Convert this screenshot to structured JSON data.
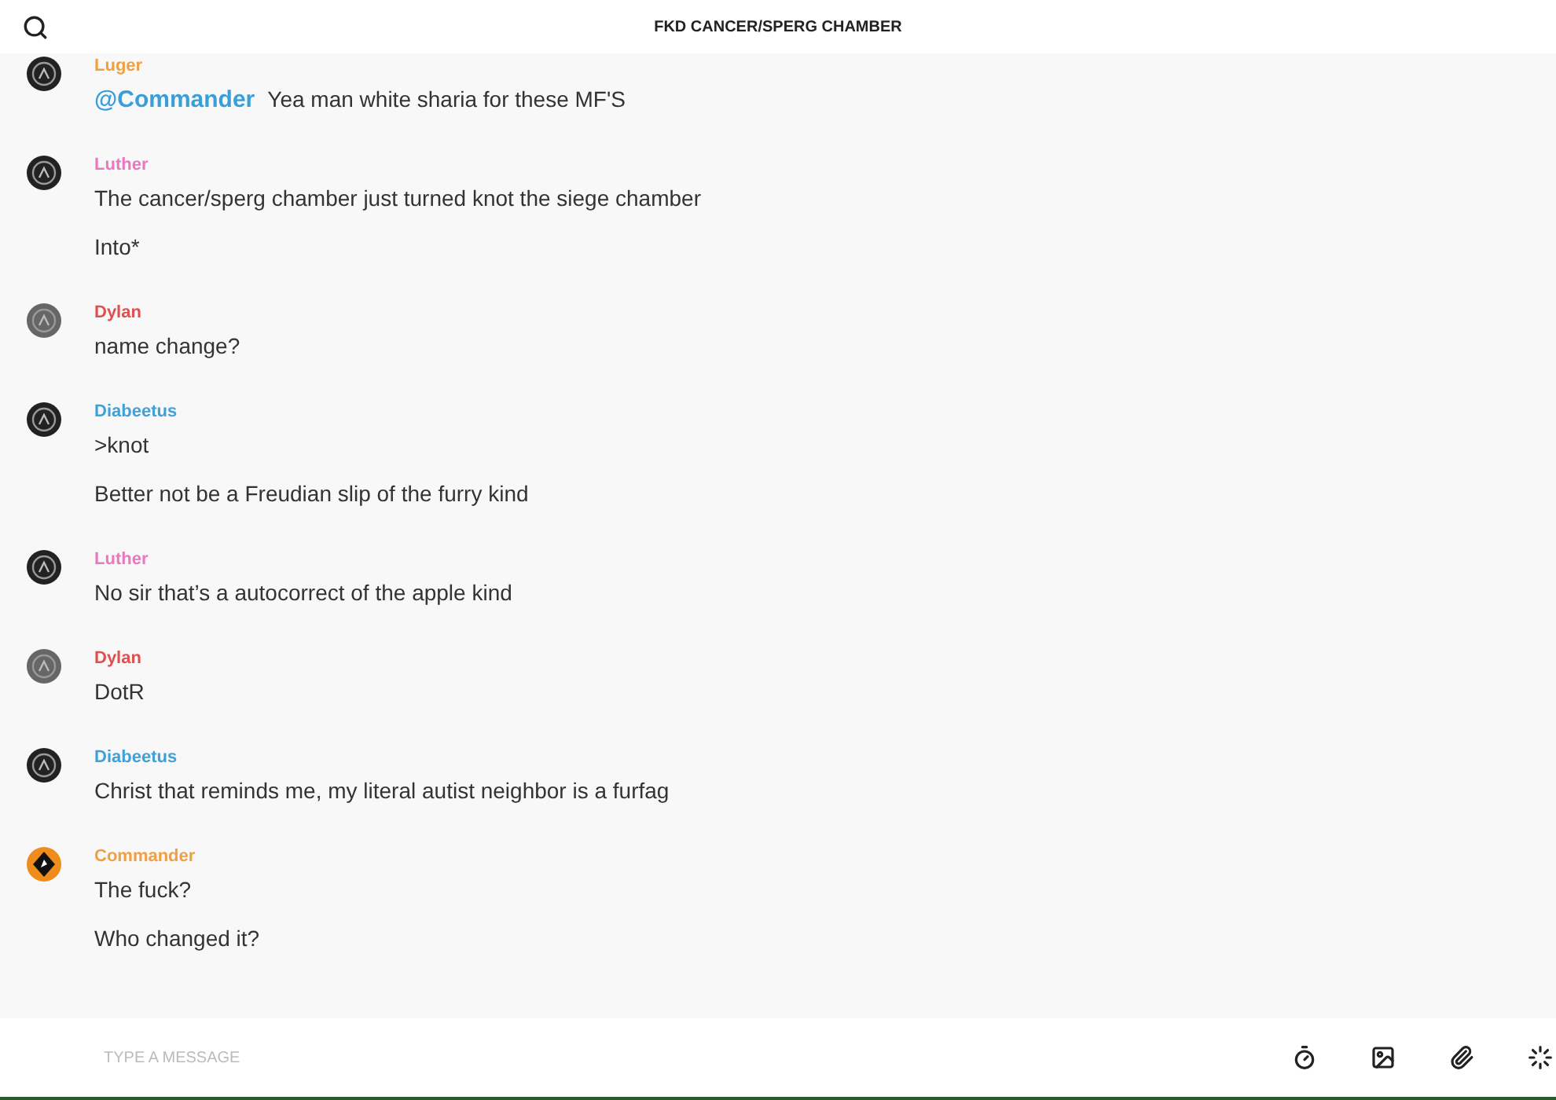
{
  "header": {
    "title": "FKD CANCER/SPERG CHAMBER"
  },
  "groups": [
    {
      "sender": "Luger",
      "color": "#f0a040",
      "avatar": {
        "kind": "dark"
      },
      "lines": [
        {
          "mention": "@Commander",
          "text": "Yea man white sharia for these MF'S"
        }
      ]
    },
    {
      "sender": "Luther",
      "color": "#e878c0",
      "avatar": {
        "kind": "dark"
      },
      "lines": [
        {
          "text": "The cancer/sperg chamber just turned knot the siege chamber"
        },
        {
          "text": "Into*"
        }
      ]
    },
    {
      "sender": "Dylan",
      "color": "#e05050",
      "avatar": {
        "kind": "grey"
      },
      "lines": [
        {
          "text": "name change?"
        }
      ]
    },
    {
      "sender": "Diabeetus",
      "color": "#40a0d8",
      "avatar": {
        "kind": "dark"
      },
      "lines": [
        {
          "text": ">knot"
        },
        {
          "text": "Better not be a Freudian slip of the furry kind"
        }
      ]
    },
    {
      "sender": "Luther",
      "color": "#e878c0",
      "avatar": {
        "kind": "dark"
      },
      "lines": [
        {
          "text": "No sir that’s a autocorrect of the apple kind"
        }
      ]
    },
    {
      "sender": "Dylan",
      "color": "#e05050",
      "avatar": {
        "kind": "grey"
      },
      "lines": [
        {
          "text": "DotR"
        }
      ]
    },
    {
      "sender": "Diabeetus",
      "color": "#40a0d8",
      "avatar": {
        "kind": "dark"
      },
      "lines": [
        {
          "text": "Christ that reminds me, my literal autist neighbor is a furfag"
        }
      ]
    },
    {
      "sender": "Commander",
      "color": "#f0a040",
      "avatar": {
        "kind": "badge"
      },
      "lines": [
        {
          "text": "The fuck?"
        },
        {
          "text": "Who changed it?"
        }
      ]
    }
  ],
  "composer": {
    "placeholder": "TYPE A MESSAGE"
  }
}
